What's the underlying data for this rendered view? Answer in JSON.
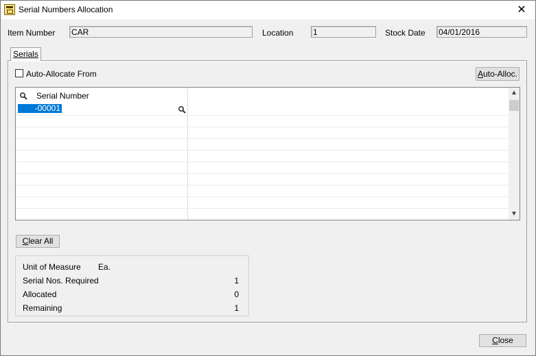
{
  "window": {
    "title": "Serial Numbers Allocation",
    "close_glyph": "✕"
  },
  "header": {
    "item_number_label": "Item Number",
    "item_number_value": "CAR",
    "location_label": "Location",
    "location_value": "1",
    "stock_date_label": "Stock Date",
    "stock_date_value": "04/01/2016"
  },
  "tabs": [
    {
      "label": "Serials"
    }
  ],
  "options": {
    "auto_allocate_label": "Auto-Allocate From",
    "auto_alloc_button": "Auto-Alloc.",
    "auto_alloc_button_prefix": "A",
    "auto_alloc_button_rest": "uto-Alloc."
  },
  "grid": {
    "columns": [
      "Serial Number"
    ],
    "rows": [
      {
        "serial": "-00001"
      }
    ]
  },
  "clear_all_button": {
    "prefix": "C",
    "rest": "lear All"
  },
  "summary": {
    "unit_of_measure_label": "Unit of Measure",
    "unit_of_measure_value": "Ea.",
    "serial_required_label": "Serial Nos. Required",
    "serial_required_value": "1",
    "allocated_label": "Allocated",
    "allocated_value": "0",
    "remaining_label": "Remaining",
    "remaining_value": "1"
  },
  "close_button": {
    "prefix": "C",
    "rest": "lose"
  }
}
